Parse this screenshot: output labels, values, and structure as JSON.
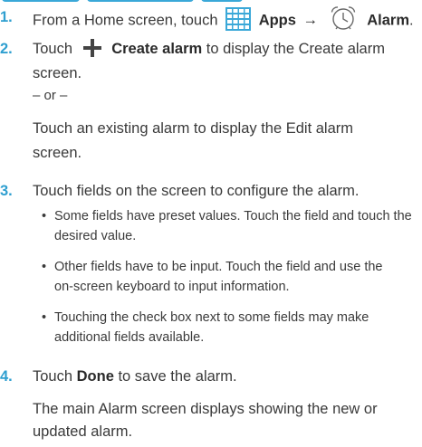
{
  "icons": {
    "apps": "apps-grid-icon",
    "alarm": "alarm-clock-icon",
    "create": "plus-icon",
    "arrow": "right-arrow-glyph"
  },
  "colors": {
    "step_number": "#2f9fd0",
    "apps_icon": "#3aa8d8",
    "text": "#3a3a3a"
  },
  "steps": {
    "s1": {
      "num": "1.",
      "pre": "From a Home screen, touch",
      "apps": "Apps",
      "arrow": "→",
      "alarm": "Alarm",
      "end": "."
    },
    "s2": {
      "num": "2.",
      "pre": "Touch",
      "create": "Create alarm",
      "post": " to display the Create alarm",
      "line2": "screen.",
      "or": "– or –",
      "alt1": "Touch an existing alarm to display the Edit alarm",
      "alt2": "screen."
    },
    "s3": {
      "num": "3.",
      "text": "Touch fields on the screen to configure the alarm.",
      "b1a": "Some fields have preset values. Touch the field and touch the",
      "b1b": "desired value.",
      "b2a": "Other fields have to be input. Touch the field and use the",
      "b2b": "on-screen keyboard to input information.",
      "b3a": "Touching the check box next to some fields may make",
      "b3b": "additional fields available."
    },
    "s4": {
      "num": "4.",
      "pre": "Touch",
      "done": "Done",
      "post": " to save the alarm.",
      "r1": "The main Alarm screen displays showing the new or",
      "r2": "updated alarm."
    }
  }
}
